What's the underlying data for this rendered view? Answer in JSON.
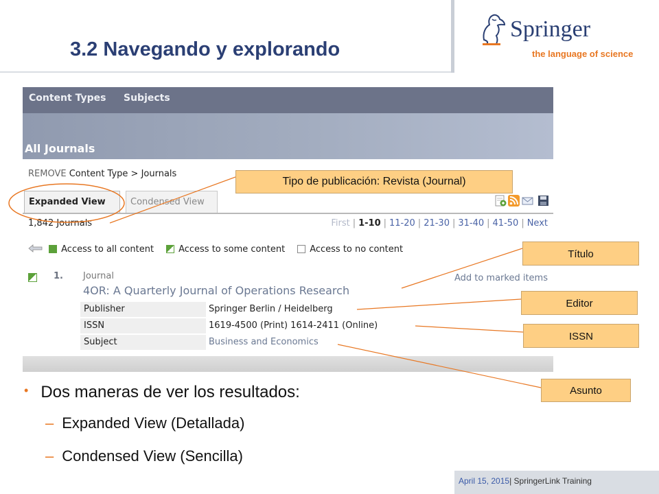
{
  "slide": {
    "title": "3.2 Navegando y explorando"
  },
  "logo": {
    "brand": "Springer",
    "tagline": "the language of science"
  },
  "screenshot": {
    "nav": {
      "content_types": "Content Types",
      "subjects": "Subjects"
    },
    "banner_title": "All Journals",
    "breadcrumb": {
      "remove": "REMOVE",
      "path": "Content Type > Journals"
    },
    "tabs": [
      {
        "label": "Expanded View"
      },
      {
        "label": "Condensed View"
      }
    ],
    "result_count": "1,842 Journals",
    "pagination": {
      "first": "First",
      "pages": [
        "1-10",
        "11-20",
        "21-30",
        "31-40",
        "41-50"
      ],
      "next": "Next"
    },
    "access_legend": {
      "all": "Access to all content",
      "some": "Access to some content",
      "none": "Access to no content"
    },
    "result": {
      "number": "1.",
      "type": "Journal",
      "mark": "Add to marked items",
      "title": "4OR: A Quarterly Journal of Operations Research",
      "publisher_label": "Publisher",
      "publisher_value": "Springer Berlin / Heidelberg",
      "issn_label": "ISSN",
      "issn_value": "1619-4500 (Print) 1614-2411 (Online)",
      "subject_label": "Subject",
      "subject_value": "Business and Economics"
    },
    "icons": [
      "save-icon",
      "rss-icon",
      "email-icon",
      "disk-icon"
    ]
  },
  "callouts": {
    "type": "Tipo de publicación: Revista (Journal)",
    "title": "Título",
    "editor": "Editor",
    "issn": "ISSN",
    "subject": "Asunto"
  },
  "bullets": {
    "main": "Dos maneras de ver los resultados:",
    "sub": [
      "Expanded View (Detallada)",
      "Condensed View (Sencilla)"
    ]
  },
  "footer": {
    "date": "April 15, 2015",
    "separator": "|",
    "label": " SpringerLink Training"
  },
  "colors": {
    "title_blue": "#2b3f74",
    "accent_orange": "#e87722",
    "callout_fill": "#fecf84",
    "nav_bar": "#6c7389"
  }
}
